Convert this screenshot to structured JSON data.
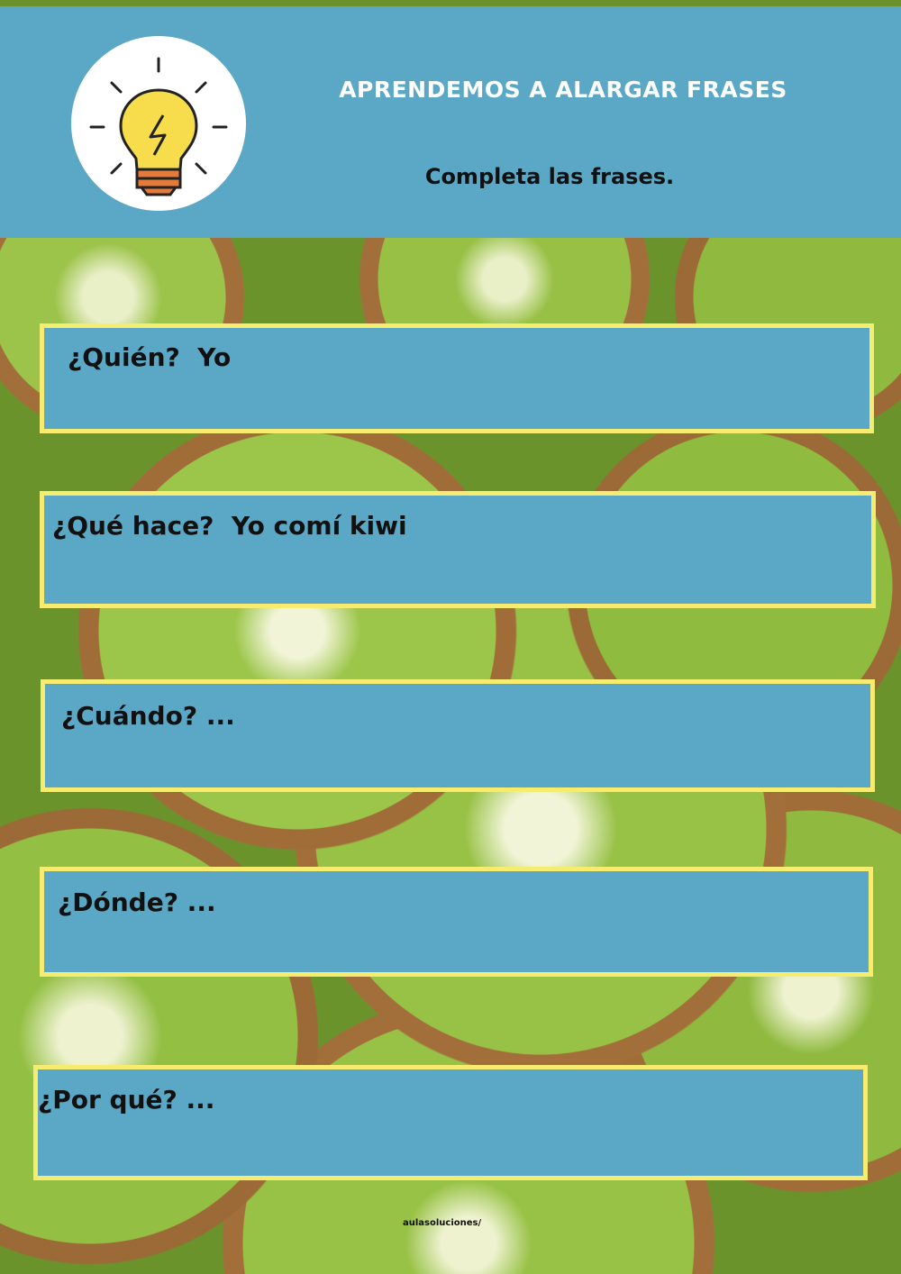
{
  "header": {
    "title": "APRENDEMOS A ALARGAR FRASES",
    "subtitle": "Completa las frases.",
    "icon": "lightbulb-icon",
    "colors": {
      "banner": "#5aa8c6",
      "bulb": "#f7dc4b",
      "bulb_base": "#e57b3a"
    }
  },
  "questions": [
    {
      "text": "¿Quién?  Yo"
    },
    {
      "text": "¿Qué hace?  Yo comí kiwi"
    },
    {
      "text": "¿Cuándo? ..."
    },
    {
      "text": "¿Dónde? ..."
    },
    {
      "text": "¿Por qué? ..."
    }
  ],
  "footer": {
    "credit": "aulasoluciones/"
  },
  "colors": {
    "box_fill": "#5aa8c6",
    "box_border": "#f6ec70"
  }
}
